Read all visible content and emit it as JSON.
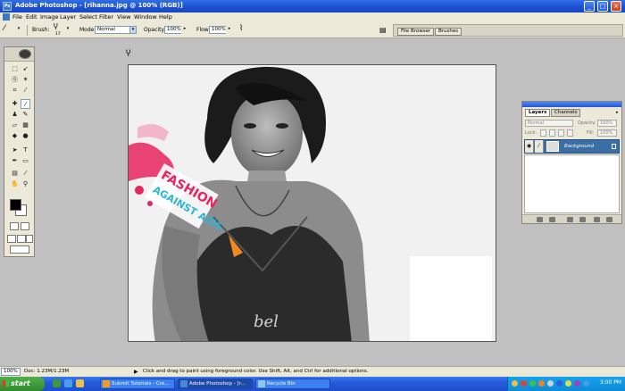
{
  "window": {
    "title": "Adobe Photoshop - [rihanna.jpg @ 100% (RGB)]"
  },
  "menu": [
    "File",
    "Edit",
    "Image",
    "Layer",
    "Select",
    "Filter",
    "View",
    "Window",
    "Help"
  ],
  "options": {
    "brush_label": "Brush:",
    "brush_size": "17",
    "mode_label": "Mode:",
    "mode_value": "Normal",
    "opacity_label": "Opacity:",
    "opacity_value": "100%",
    "flow_label": "Flow:",
    "flow_value": "100%"
  },
  "palette_well": {
    "tabs": [
      "File Browser",
      "Brushes"
    ]
  },
  "canvas": {
    "art_text_1": "FASHION",
    "art_text_2": "AGAINST AIDS",
    "shirt_text": "bel"
  },
  "layers_palette": {
    "tabs": [
      "Layers",
      "Channels"
    ],
    "blend_mode": "Normal",
    "opacity_label": "Opacity:",
    "opacity_value": "100%",
    "lock_label": "Lock:",
    "fill_label": "Fill:",
    "fill_value": "100%",
    "layer_name": "Background"
  },
  "status": {
    "zoom": "100%",
    "doc": "Doc: 1.23M/1.23M",
    "hint": "Click and drag to paint using foreground color.  Use Shift, Alt, and Ctrl for additional options."
  },
  "taskbar": {
    "start": "start",
    "tasks": [
      "Submit Tutorials - Cre...",
      "Adobe Photoshop - [r...",
      "Recycle Bin"
    ],
    "clock": "3:00 PM"
  },
  "colors": {
    "foreground": "#000000",
    "background": "#ffffff",
    "xp_blue": "#2459d9",
    "art_pink": "#e8245f",
    "art_cyan": "#2cb4d8",
    "art_orange": "#f08a1c"
  }
}
